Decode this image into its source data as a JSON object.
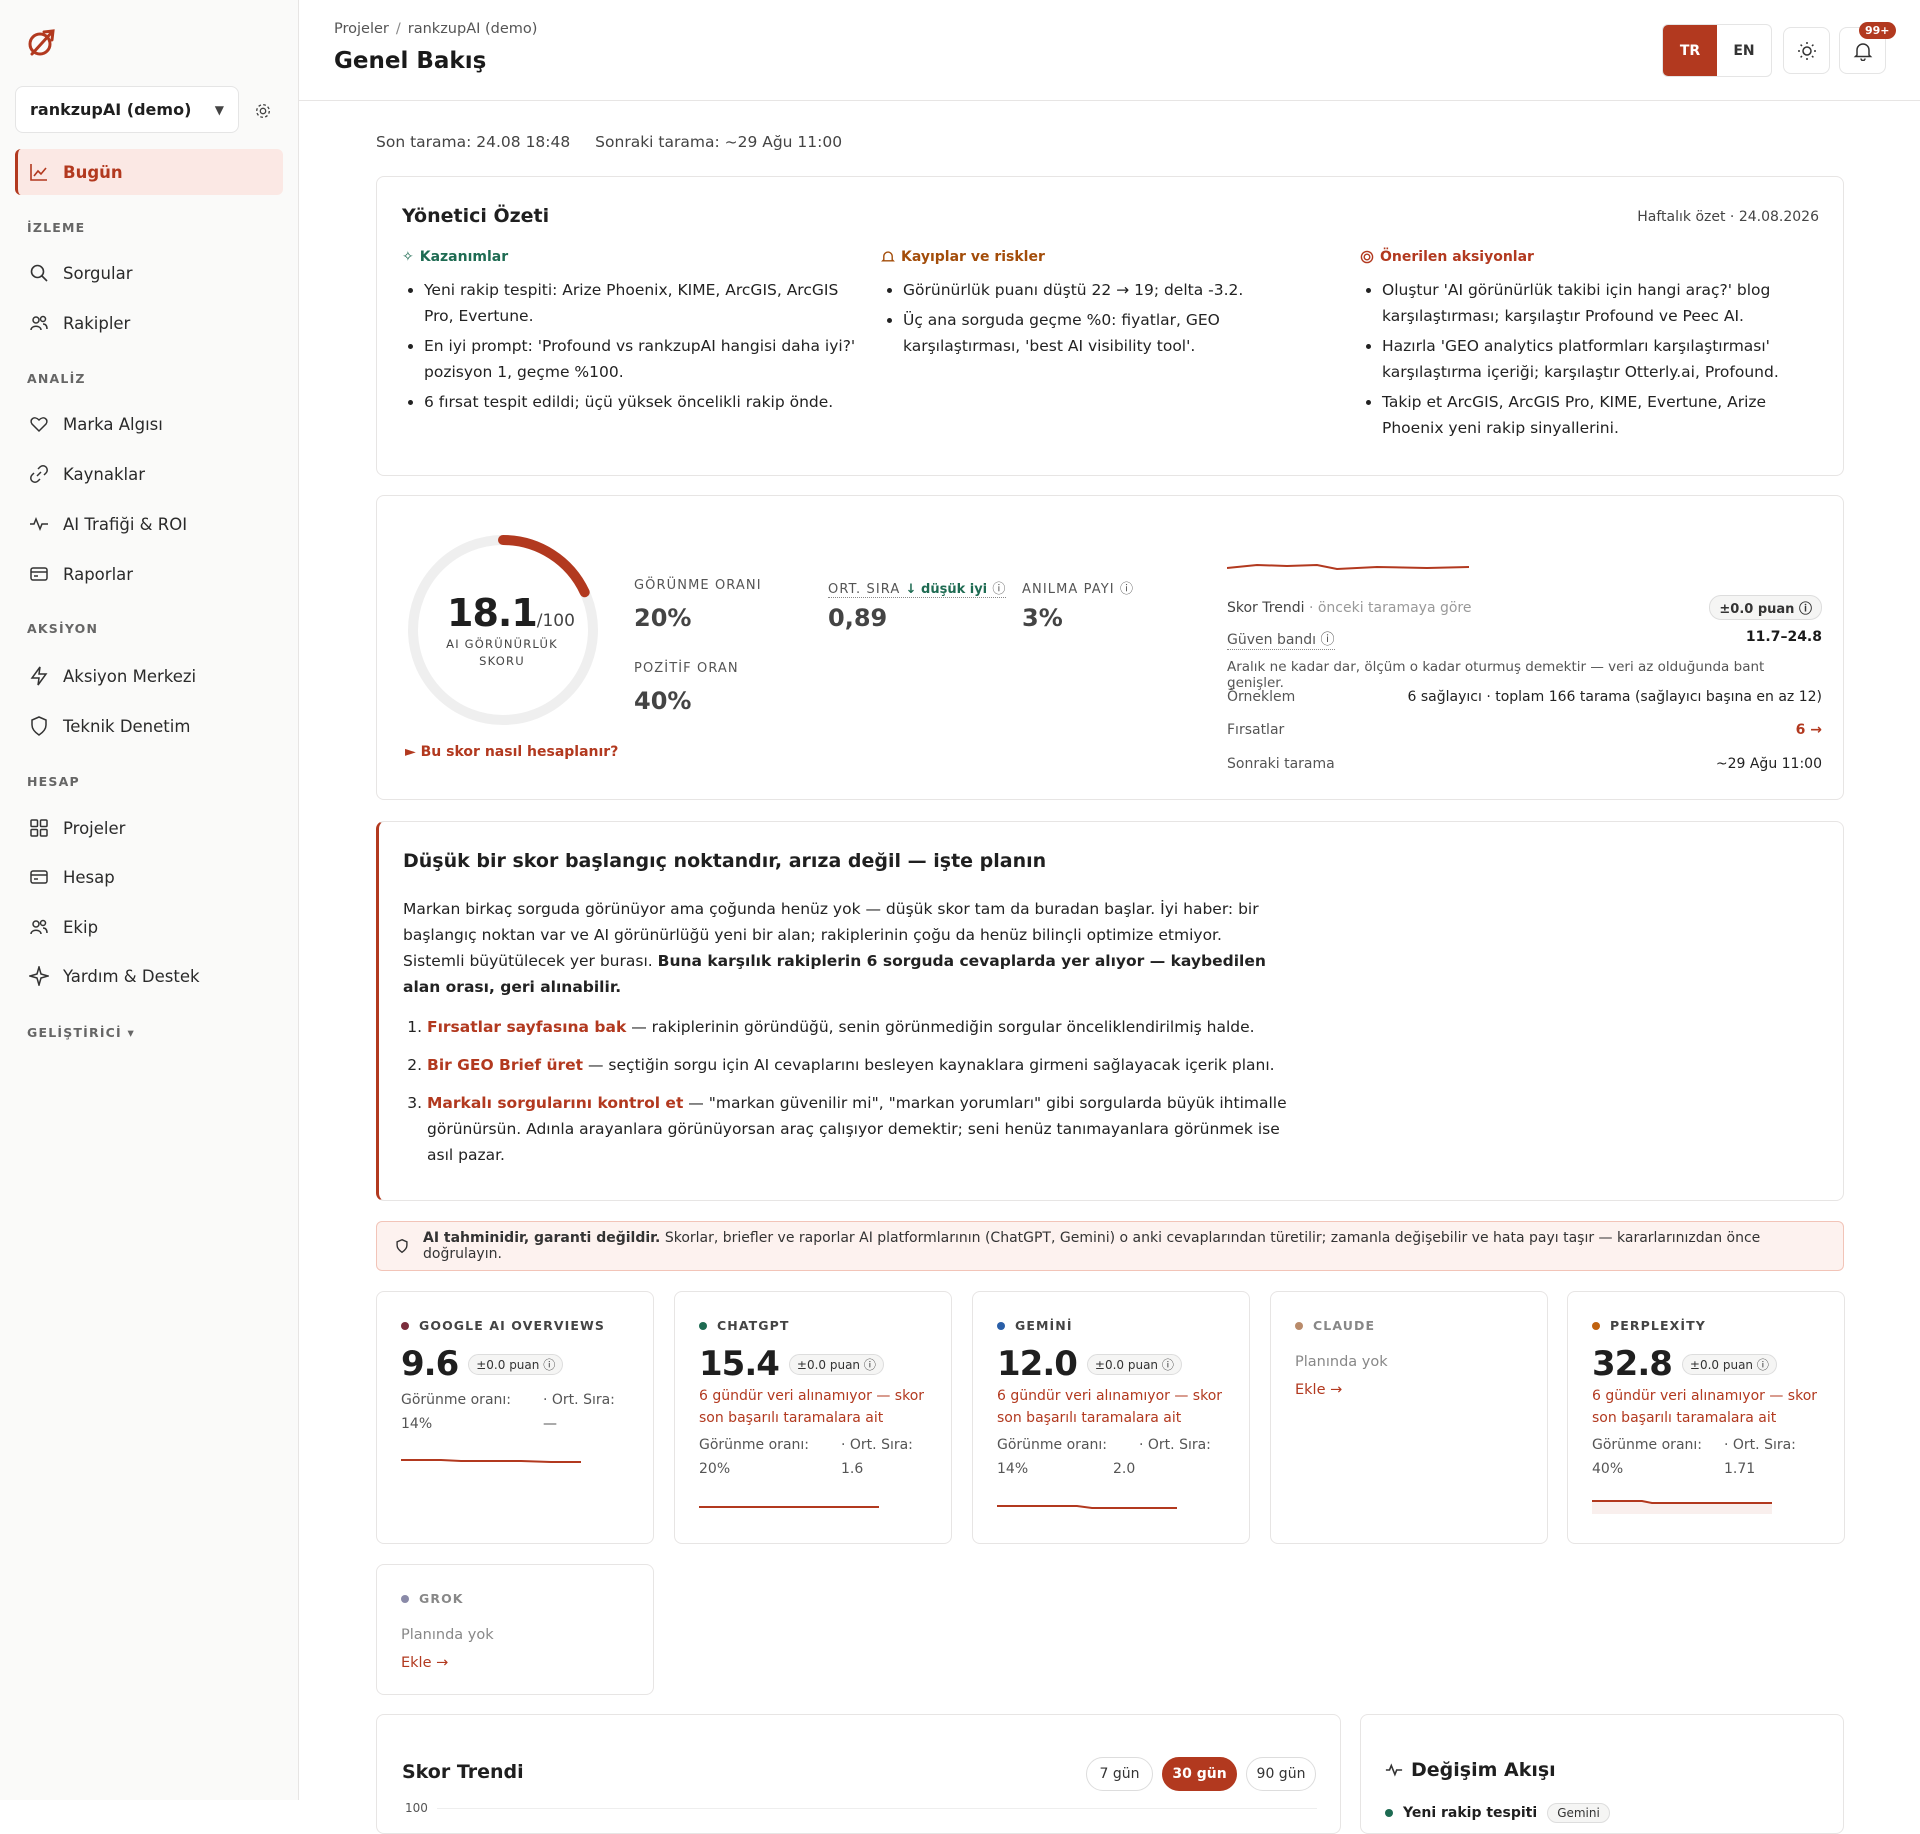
{
  "sidebar": {
    "project_name": "rankzupAI (demo)",
    "active_item": "Bugün",
    "sections": {
      "izleme": "İZLEME",
      "analiz": "ANALİZ",
      "aksiyon": "AKSİYON",
      "hesap": "HESAP",
      "gelistirici": "GELİŞTİRİCİ ▾"
    },
    "items": {
      "bugun": "Bugün",
      "sorgular": "Sorgular",
      "rakipler": "Rakipler",
      "marka": "Marka Algısı",
      "kaynaklar": "Kaynaklar",
      "trafik": "AI Trafiği & ROI",
      "raporlar": "Raporlar",
      "aksiyon_merkezi": "Aksiyon Merkezi",
      "teknik": "Teknik Denetim",
      "projeler": "Projeler",
      "hesap": "Hesap",
      "ekip": "Ekip",
      "yardim": "Yardım & Destek"
    }
  },
  "header": {
    "breadcrumb_root": "Projeler",
    "breadcrumb_sep": "/",
    "breadcrumb_current": "rankzupAI (demo)",
    "title": "Genel Bakış",
    "lang_tr": "TR",
    "lang_en": "EN",
    "notif_badge": "99+"
  },
  "scan": {
    "last": "Son tarama: 24.08 18:48",
    "next": "Sonraki tarama: ~29 Ağu 11:00"
  },
  "exec": {
    "title": "Yönetici Özeti",
    "date": "Haftalık özet · 24.08.2026",
    "wins_title": "Kazanımlar",
    "wins": [
      "Yeni rakip tespiti: Arize Phoenix, KIME, ArcGIS, ArcGIS Pro, Evertune.",
      "En iyi prompt: 'Profound vs rankzupAI hangisi daha iyi?' pozisyon 1, geçme %100.",
      "6 fırsat tespit edildi; üçü yüksek öncelikli rakip önde."
    ],
    "risks_title": "Kayıplar ve riskler",
    "risks": [
      "Görünürlük puanı düştü 22 → 19; delta -3.2.",
      "Üç ana sorguda geçme %0: fiyatlar, GEO karşılaştırması, 'best AI visibility tool'."
    ],
    "actions_title": "Önerilen aksiyonlar",
    "actions": [
      "Oluştur 'AI görünürlük takibi için hangi araç?' blog karşılaştırması; karşılaştır Profound ve Peec AI.",
      "Hazırla 'GEO analytics platformları karşılaştırması' karşılaştırma içeriği; karşılaştır Otterly.ai, Profound.",
      "Takip et ArcGIS, ArcGIS Pro, KIME, Evertune, Arize Phoenix yeni rakip sinyallerini."
    ]
  },
  "score": {
    "value": "18.1",
    "max": "/100",
    "fraction": 0.181,
    "label": "AI GÖRÜNÜRLÜK SKORU",
    "how": "► Bu skor nasıl hesaplanır?",
    "metrics": {
      "gorunme_lbl": "GÖRÜNME ORANI",
      "gorunme_val": "20%",
      "sira_lbl": "ORT. SIRA",
      "sira_hint": "↓ düşük iyi",
      "sira_val": "0,89",
      "anilma_lbl": "ANILMA PAYI",
      "anilma_val": "3%",
      "pozitif_lbl": "POZİTİF ORAN",
      "pozitif_val": "40%"
    },
    "side": {
      "trend_lbl": "Skor Trendi",
      "trend_sub": "· önceki taramaya göre",
      "trend_delta": "±0.0 puan",
      "band_lbl": "Güven bandı",
      "band_val": "11.7–24.8",
      "band_note": "Aralık ne kadar dar, ölçüm o kadar oturmuş demektir — veri az olduğunda bant genişler.",
      "sample_lbl": "Örneklem",
      "sample_val": "6 sağlayıcı · toplam 166 tarama (sağlayıcı başına en az 12)",
      "opp_lbl": "Fırsatlar",
      "opp_val": "6 →",
      "next_lbl": "Sonraki tarama",
      "next_val": "~29 Ağu 11:00"
    }
  },
  "plan": {
    "title": "Düşük bir skor başlangıç noktandır, arıza değil — işte planın",
    "p_normal": "Markan birkaç sorguda görünüyor ama çoğunda henüz yok — düşük skor tam da buradan başlar. İyi haber: bir başlangıç noktan var ve AI görünürlüğü yeni bir alan; rakiplerinin çoğu da henüz bilinçli optimize etmiyor. Sistemli büyütülecek yer burası. ",
    "p_bold": "Buna karşılık rakiplerin 6 sorguda cevaplarda yer alıyor — kaybedilen alan orası, geri alınabilir.",
    "steps": [
      {
        "link": "Fırsatlar sayfasına bak",
        "text": " — rakiplerinin göründüğü, senin görünmediğin sorgular önceliklendirilmiş halde."
      },
      {
        "link": "Bir GEO Brief üret",
        "text": " — seçtiğin sorgu için AI cevaplarını besleyen kaynaklara girmeni sağlayacak içerik planı."
      },
      {
        "link": "Markalı sorgularını kontrol et",
        "text": " — \"markan güvenilir mi\", \"markan yorumları\" gibi sorgularda büyük ihtimalle görünürsün. Adınla arayanlara görünüyorsan araç çalışıyor demektir; seni henüz tanımayanlara görünmek ise asıl pazar."
      }
    ]
  },
  "warning": {
    "bold": "AI tahminidir, garanti değildir.",
    "text": " Skorlar, briefler ve raporlar AI platformlarının (ChatGPT, Gemini) o anki cevaplarından türetilir; zamanla değişebilir ve hata payı taşır — kararlarınızdan önce doğrulayın."
  },
  "platforms": {
    "delta": "±0.0 puan",
    "stale": "6 gündür veri alınamıyor — skor son başarılı taramalara ait",
    "vis_lbl": "Görünme oranı:",
    "rank_lbl": "· Ort. Sıra:",
    "noplan": "Planında yok",
    "add": "Ekle →",
    "google": {
      "name": "GOOGLE AI OVERVIEWS",
      "score": "9.6",
      "vis": "14%",
      "rank": "—",
      "color": "#7a2d3c"
    },
    "chatgpt": {
      "name": "CHATGPT",
      "score": "15.4",
      "vis": "20%",
      "rank": "1.6",
      "color": "#1e6b52"
    },
    "gemini": {
      "name": "GEMİNİ",
      "score": "12.0",
      "vis": "14%",
      "rank": "2.0",
      "color": "#2a5fa8"
    },
    "claude": {
      "name": "CLAUDE",
      "color": "#b98b6a"
    },
    "perplexity": {
      "name": "PERPLEXİTY",
      "score": "32.8",
      "vis": "40%",
      "rank": "1.71",
      "color": "#c0620f"
    },
    "grok": {
      "name": "GROK",
      "color": "#8a8aa8"
    }
  },
  "trend": {
    "title": "Skor Trendi",
    "tab7": "7 gün",
    "tab30": "30 gün",
    "tab90": "90 gün",
    "y_top": "100"
  },
  "feed": {
    "title": "Değişim Akışı",
    "first_item": "Yeni rakip tespiti",
    "first_tag": "Gemini"
  },
  "colors": {
    "accent": "#b2391f",
    "positive": "#1e6b52"
  }
}
